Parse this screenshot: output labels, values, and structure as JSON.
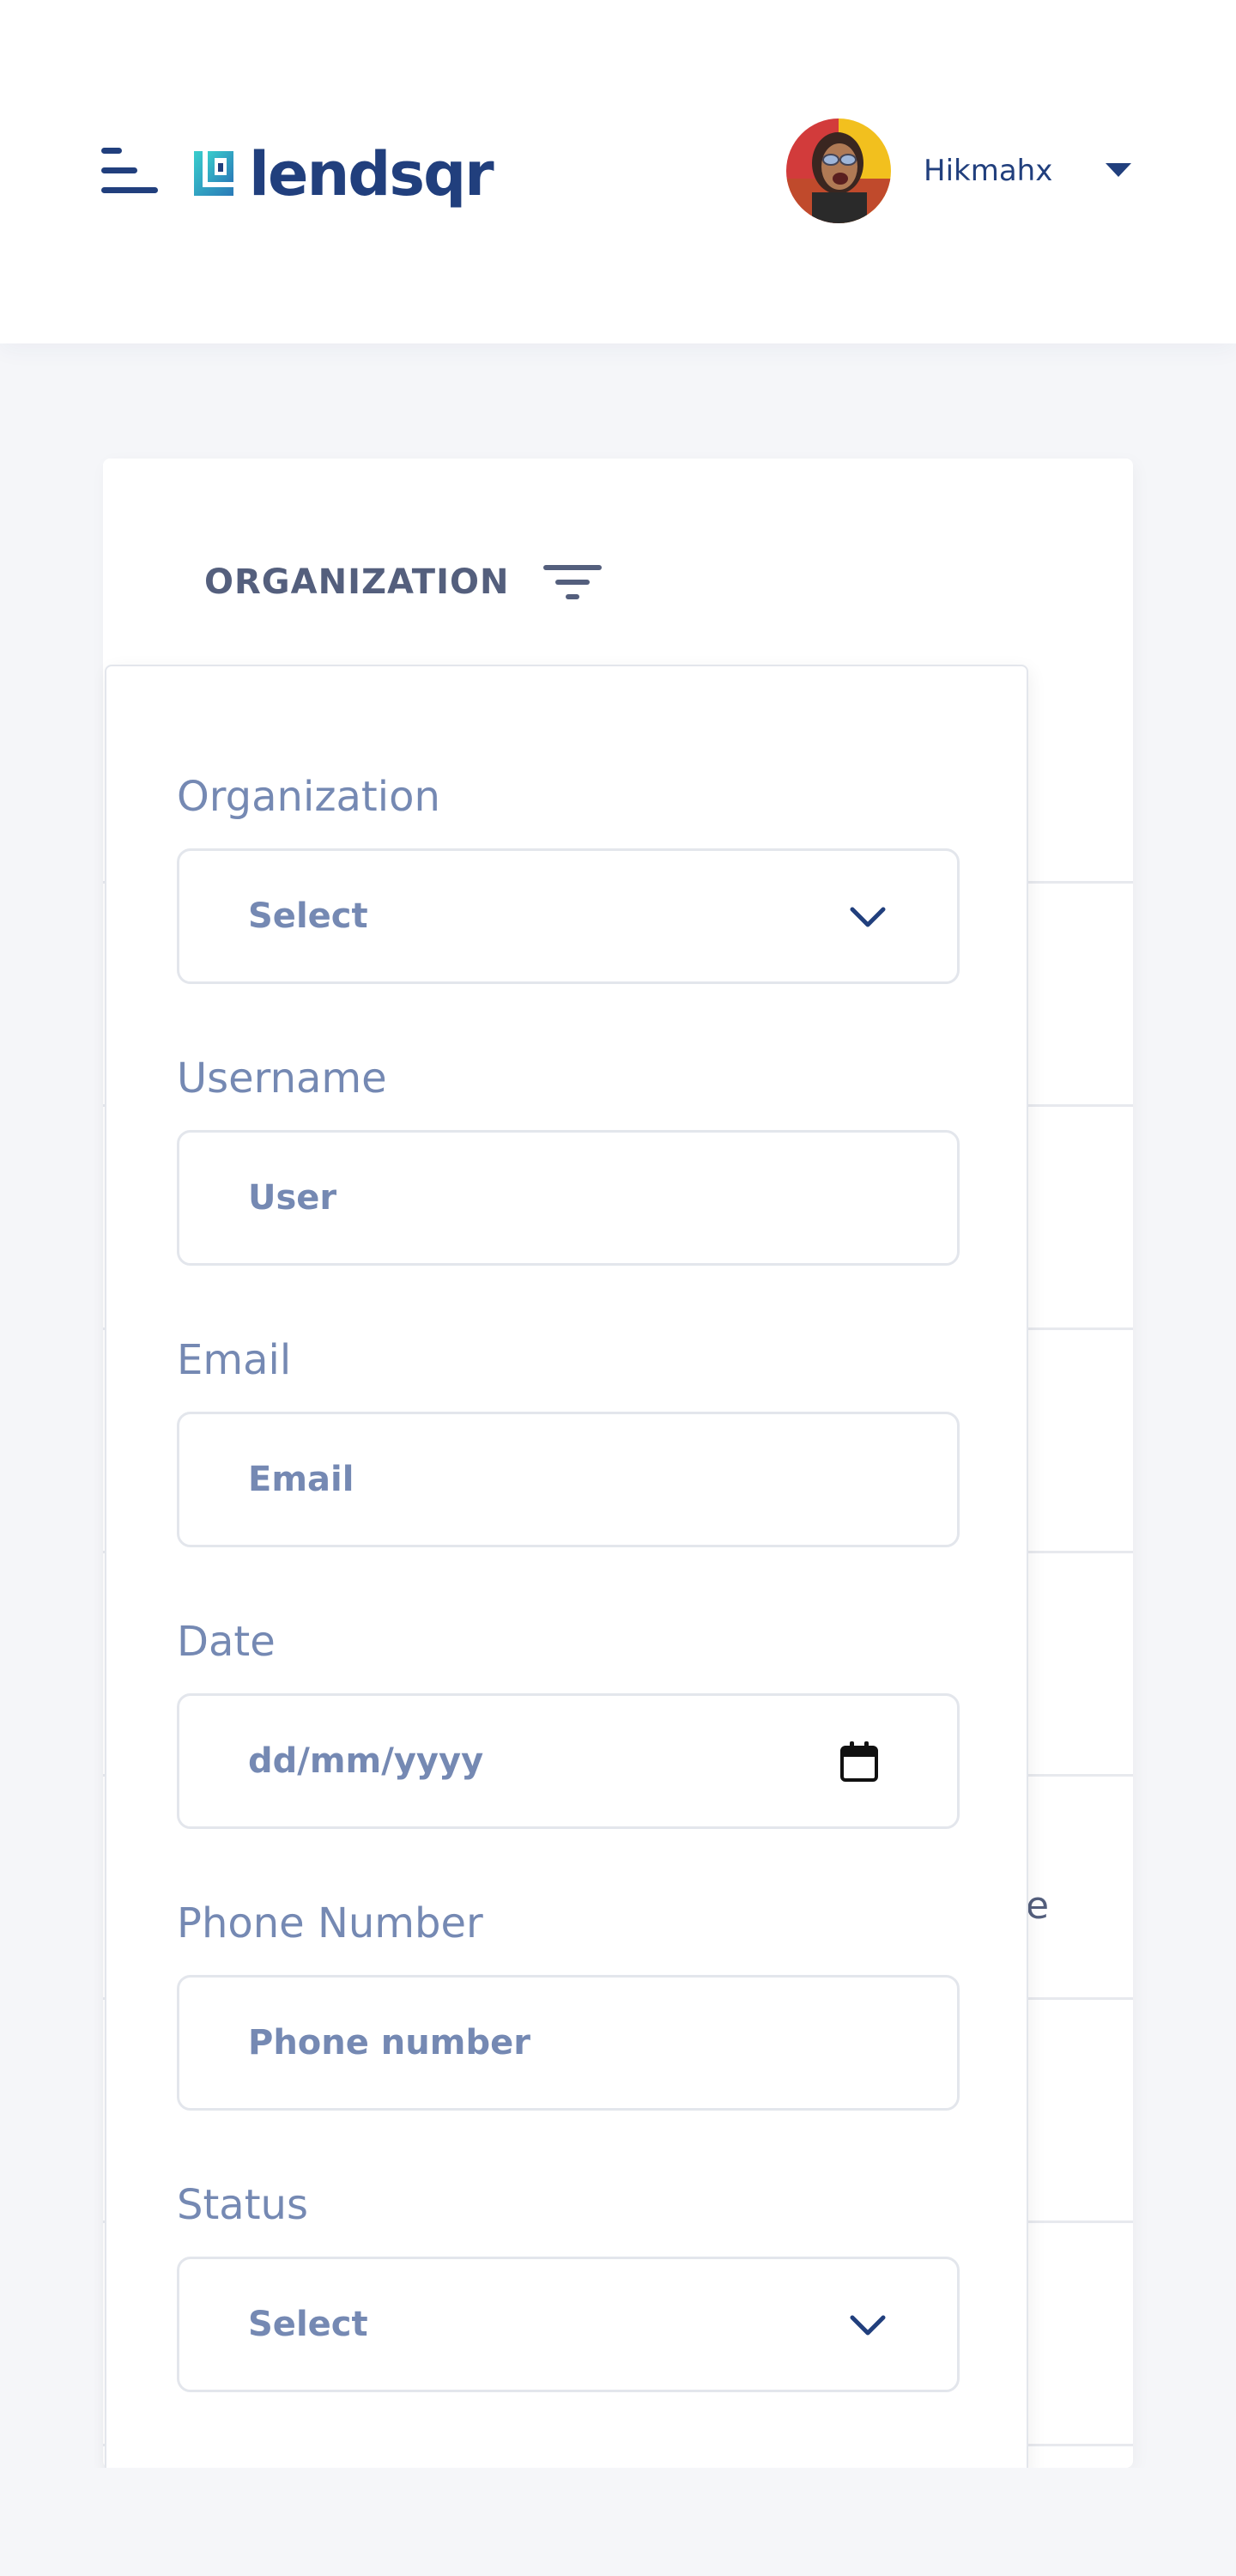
{
  "header": {
    "logo_text": "lendsqr",
    "user_name": "Hikmahx",
    "colors": {
      "brand": "#213f7d",
      "accent": "#39cdcc"
    }
  },
  "table": {
    "column_title": "ORGANIZATION",
    "peek_text": "e"
  },
  "filter": {
    "organization": {
      "label": "Organization",
      "value": "Select"
    },
    "username": {
      "label": "Username",
      "placeholder": "User"
    },
    "email": {
      "label": "Email",
      "placeholder": "Email"
    },
    "date": {
      "label": "Date",
      "placeholder": "dd/mm/yyyy"
    },
    "phone": {
      "label": "Phone Number",
      "placeholder": "Phone number"
    },
    "status": {
      "label": "Status",
      "value": "Select"
    }
  },
  "icons": {
    "menu": "menu-icon",
    "filter": "filter-icon",
    "chevron": "chevron-down-icon",
    "calendar": "calendar-icon",
    "caret": "caret-down-icon"
  }
}
